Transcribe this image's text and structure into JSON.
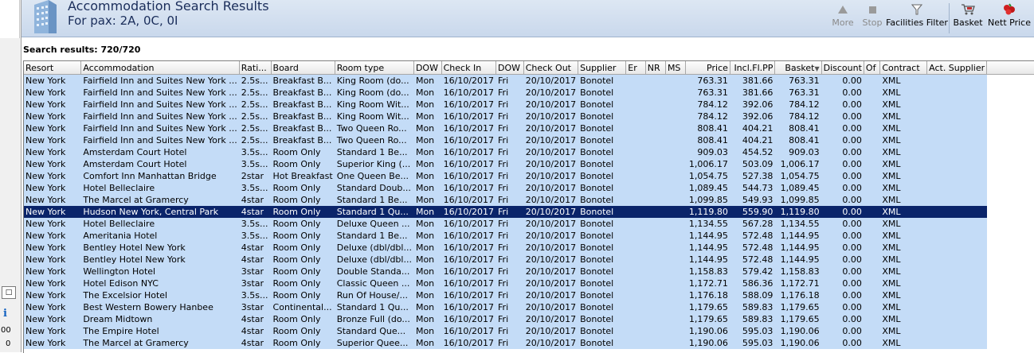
{
  "header": {
    "title": "Accommodation Search Results",
    "subtitle": "For pax: 2A, 0C, 0I"
  },
  "toolbar": {
    "more": "More",
    "stop": "Stop",
    "facilities_filter": "Facilities Filter",
    "basket": "Basket",
    "nett_price": "Nett Price"
  },
  "left": {
    "val1": "00",
    "val2": "0"
  },
  "search_count": "Search results: 720/720",
  "columns": [
    "Resort",
    "Accommodation",
    "Rati...",
    "Board",
    "Room type",
    "DOW",
    "Check In",
    "DOW",
    "Check Out",
    "Supplier",
    "Er",
    "NR",
    "MS",
    "Price",
    "Incl.Fl.PP",
    "Basket",
    "Discount",
    "Of",
    "Contract",
    "Act. Supplier"
  ],
  "colors": {
    "row_bg": "#c4dcf7",
    "selected_bg": "#0a246a",
    "header_band": "#c9d8ec"
  },
  "rows": [
    [
      "New York",
      "Fairfield Inn and Suites New York ...",
      "2.5s...",
      "Breakfast B...",
      "King Room (do...",
      "Mon",
      "16/10/2017",
      "Fri",
      "20/10/2017",
      "Bonotel",
      "",
      "",
      "",
      "763.31",
      "381.66",
      "763.31",
      "0.00",
      "",
      "XML",
      ""
    ],
    [
      "New York",
      "Fairfield Inn and Suites New York ...",
      "2.5s...",
      "Breakfast B...",
      "King Room (do...",
      "Mon",
      "16/10/2017",
      "Fri",
      "20/10/2017",
      "Bonotel",
      "",
      "",
      "",
      "763.31",
      "381.66",
      "763.31",
      "0.00",
      "",
      "XML",
      ""
    ],
    [
      "New York",
      "Fairfield Inn and Suites New York ...",
      "2.5s...",
      "Breakfast B...",
      "King Room Wit...",
      "Mon",
      "16/10/2017",
      "Fri",
      "20/10/2017",
      "Bonotel",
      "",
      "",
      "",
      "784.12",
      "392.06",
      "784.12",
      "0.00",
      "",
      "XML",
      ""
    ],
    [
      "New York",
      "Fairfield Inn and Suites New York ...",
      "2.5s...",
      "Breakfast B...",
      "King Room Wit...",
      "Mon",
      "16/10/2017",
      "Fri",
      "20/10/2017",
      "Bonotel",
      "",
      "",
      "",
      "784.12",
      "392.06",
      "784.12",
      "0.00",
      "",
      "XML",
      ""
    ],
    [
      "New York",
      "Fairfield Inn and Suites New York ...",
      "2.5s...",
      "Breakfast B...",
      "Two Queen Ro...",
      "Mon",
      "16/10/2017",
      "Fri",
      "20/10/2017",
      "Bonotel",
      "",
      "",
      "",
      "808.41",
      "404.21",
      "808.41",
      "0.00",
      "",
      "XML",
      ""
    ],
    [
      "New York",
      "Fairfield Inn and Suites New York ...",
      "2.5s...",
      "Breakfast B...",
      "Two Queen Ro...",
      "Mon",
      "16/10/2017",
      "Fri",
      "20/10/2017",
      "Bonotel",
      "",
      "",
      "",
      "808.41",
      "404.21",
      "808.41",
      "0.00",
      "",
      "XML",
      ""
    ],
    [
      "New York",
      "Amsterdam Court Hotel",
      "3.5s...",
      "Room Only",
      "Standard 1 Be...",
      "Mon",
      "16/10/2017",
      "Fri",
      "20/10/2017",
      "Bonotel",
      "",
      "",
      "",
      "909.03",
      "454.52",
      "909.03",
      "0.00",
      "",
      "XML",
      ""
    ],
    [
      "New York",
      "Amsterdam Court Hotel",
      "3.5s...",
      "Room Only",
      "Superior King (...",
      "Mon",
      "16/10/2017",
      "Fri",
      "20/10/2017",
      "Bonotel",
      "",
      "",
      "",
      "1,006.17",
      "503.09",
      "1,006.17",
      "0.00",
      "",
      "XML",
      ""
    ],
    [
      "New York",
      "Comfort Inn Manhattan Bridge",
      "2star",
      "Hot Breakfast",
      "One Queen Be...",
      "Mon",
      "16/10/2017",
      "Fri",
      "20/10/2017",
      "Bonotel",
      "",
      "",
      "",
      "1,054.75",
      "527.38",
      "1,054.75",
      "0.00",
      "",
      "XML",
      ""
    ],
    [
      "New York",
      "Hotel Belleclaire",
      "3.5s...",
      "Room Only",
      "Standard Doub...",
      "Mon",
      "16/10/2017",
      "Fri",
      "20/10/2017",
      "Bonotel",
      "",
      "",
      "",
      "1,089.45",
      "544.73",
      "1,089.45",
      "0.00",
      "",
      "XML",
      ""
    ],
    [
      "New York",
      "The Marcel at Gramercy",
      "4star",
      "Room Only",
      "Standard 1 Be...",
      "Mon",
      "16/10/2017",
      "Fri",
      "20/10/2017",
      "Bonotel",
      "",
      "",
      "",
      "1,099.85",
      "549.93",
      "1,099.85",
      "0.00",
      "",
      "XML",
      ""
    ],
    [
      "New York",
      "Hudson New York, Central Park",
      "4star",
      "Room Only",
      "Standard 1 Qu...",
      "Mon",
      "16/10/2017",
      "Fri",
      "20/10/2017",
      "Bonotel",
      "",
      "",
      "",
      "1,119.80",
      "559.90",
      "1,119.80",
      "0.00",
      "",
      "XML",
      ""
    ],
    [
      "New York",
      "Hotel Belleclaire",
      "3.5s...",
      "Room Only",
      "Deluxe Queen ...",
      "Mon",
      "16/10/2017",
      "Fri",
      "20/10/2017",
      "Bonotel",
      "",
      "",
      "",
      "1,134.55",
      "567.28",
      "1,134.55",
      "0.00",
      "",
      "XML",
      ""
    ],
    [
      "New York",
      "Ameritania Hotel",
      "3.5s...",
      "Room Only",
      "Standard 1 Be...",
      "Mon",
      "16/10/2017",
      "Fri",
      "20/10/2017",
      "Bonotel",
      "",
      "",
      "",
      "1,144.95",
      "572.48",
      "1,144.95",
      "0.00",
      "",
      "XML",
      ""
    ],
    [
      "New York",
      "Bentley Hotel New York",
      "4star",
      "Room Only",
      "Deluxe (dbl/dbl...",
      "Mon",
      "16/10/2017",
      "Fri",
      "20/10/2017",
      "Bonotel",
      "",
      "",
      "",
      "1,144.95",
      "572.48",
      "1,144.95",
      "0.00",
      "",
      "XML",
      ""
    ],
    [
      "New York",
      "Bentley Hotel New York",
      "4star",
      "Room Only",
      "Deluxe (dbl/dbl...",
      "Mon",
      "16/10/2017",
      "Fri",
      "20/10/2017",
      "Bonotel",
      "",
      "",
      "",
      "1,144.95",
      "572.48",
      "1,144.95",
      "0.00",
      "",
      "XML",
      ""
    ],
    [
      "New York",
      "Wellington Hotel",
      "3star",
      "Room Only",
      "Double Standa...",
      "Mon",
      "16/10/2017",
      "Fri",
      "20/10/2017",
      "Bonotel",
      "",
      "",
      "",
      "1,158.83",
      "579.42",
      "1,158.83",
      "0.00",
      "",
      "XML",
      ""
    ],
    [
      "New York",
      "Hotel Edison NYC",
      "3star",
      "Room Only",
      "Classic Queen ...",
      "Mon",
      "16/10/2017",
      "Fri",
      "20/10/2017",
      "Bonotel",
      "",
      "",
      "",
      "1,172.71",
      "586.36",
      "1,172.71",
      "0.00",
      "",
      "XML",
      ""
    ],
    [
      "New York",
      "The Excelsior Hotel",
      "3.5s...",
      "Room Only",
      "Run Of House/...",
      "Mon",
      "16/10/2017",
      "Fri",
      "20/10/2017",
      "Bonotel",
      "",
      "",
      "",
      "1,176.18",
      "588.09",
      "1,176.18",
      "0.00",
      "",
      "XML",
      ""
    ],
    [
      "New York",
      "Best Western Bowery Hanbee",
      "3star",
      "Continental...",
      "Standard 1 Qu...",
      "Mon",
      "16/10/2017",
      "Fri",
      "20/10/2017",
      "Bonotel",
      "",
      "",
      "",
      "1,179.65",
      "589.83",
      "1,179.65",
      "0.00",
      "",
      "XML",
      ""
    ],
    [
      "New York",
      "Dream Midtown",
      "4star",
      "Room Only",
      "Bronze Full (do...",
      "Mon",
      "16/10/2017",
      "Fri",
      "20/10/2017",
      "Bonotel",
      "",
      "",
      "",
      "1,179.65",
      "589.83",
      "1,179.65",
      "0.00",
      "",
      "XML",
      ""
    ],
    [
      "New York",
      "The Empire Hotel",
      "4star",
      "Room Only",
      "Standard Que...",
      "Mon",
      "16/10/2017",
      "Fri",
      "20/10/2017",
      "Bonotel",
      "",
      "",
      "",
      "1,190.06",
      "595.03",
      "1,190.06",
      "0.00",
      "",
      "XML",
      ""
    ],
    [
      "New York",
      "The Marcel at Gramercy",
      "4star",
      "Room Only",
      "Superior Quee...",
      "Mon",
      "16/10/2017",
      "Fri",
      "20/10/2017",
      "Bonotel",
      "",
      "",
      "",
      "1,190.06",
      "595.03",
      "1,190.06",
      "0.00",
      "",
      "XML",
      ""
    ]
  ],
  "selected_row": 11
}
